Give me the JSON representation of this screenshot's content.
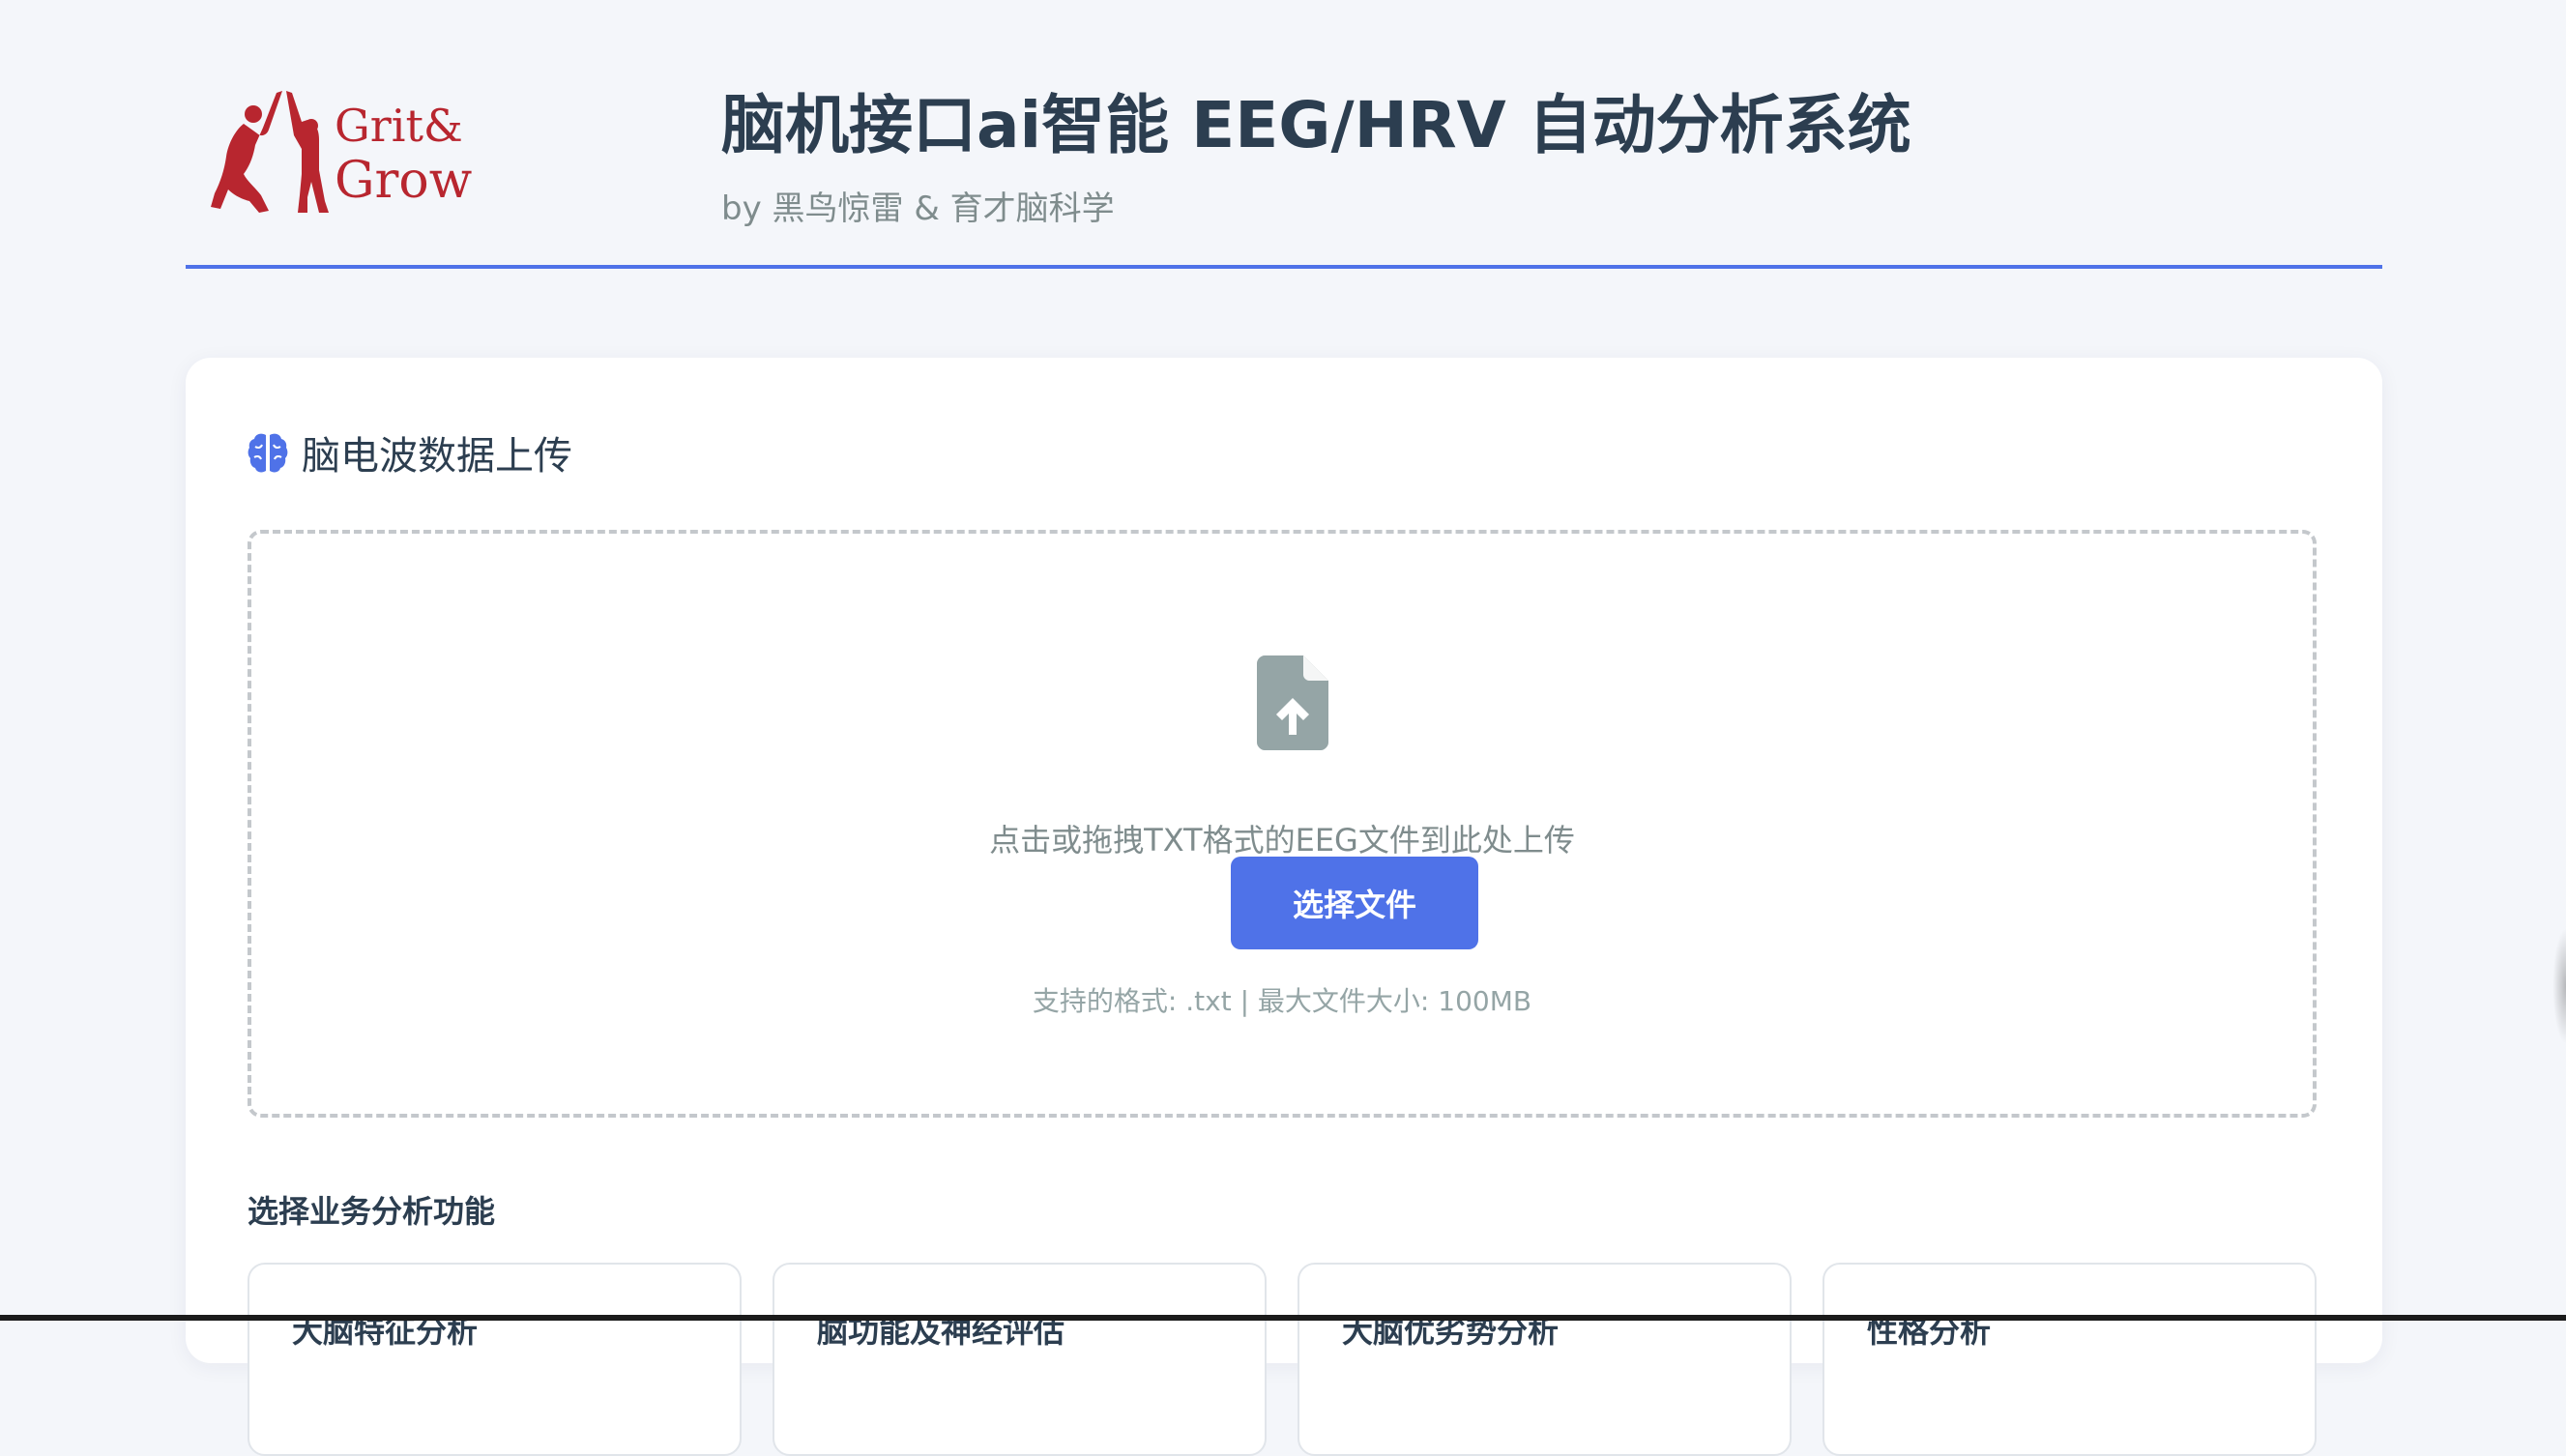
{
  "header": {
    "logo_text": "Grit& Grow",
    "title": "脑机接口ai智能 EEG/HRV 自动分析系统",
    "subtitle": "by 黑鸟惊雷 & 育才脑科学"
  },
  "upload": {
    "section_icon": "brain-icon",
    "section_title": "脑电波数据上传",
    "upload_icon": "file-upload-icon",
    "drop_text": "点击或拖拽TXT格式的EEG文件到此处上传",
    "choose_button": "选择文件",
    "formats_text": "支持的格式: .txt | 最大文件大小: 100MB"
  },
  "functions": {
    "label": "选择业务分析功能",
    "items": [
      {
        "label": "大脑特征分析"
      },
      {
        "label": "脑功能及神经评估"
      },
      {
        "label": "大脑优劣势分析"
      },
      {
        "label": "性格分析"
      }
    ]
  },
  "colors": {
    "accent": "#4f72e8",
    "title": "#2c3e50",
    "muted": "#7f8c8d",
    "logo_red": "#b8262f",
    "icon_gray": "#95a5a6"
  }
}
